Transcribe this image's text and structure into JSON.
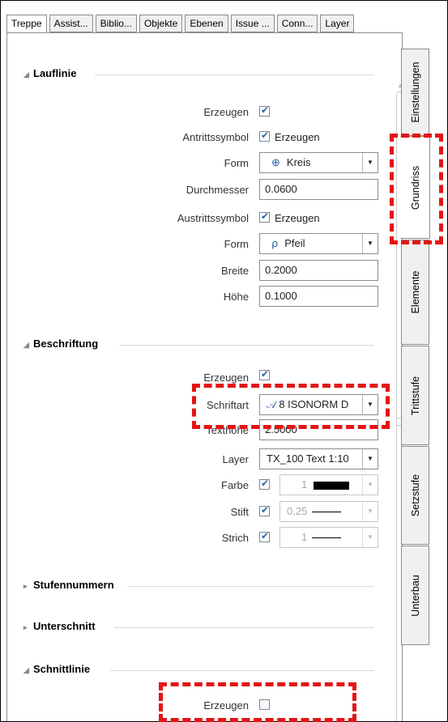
{
  "tabs": [
    "Treppe",
    "Assist...",
    "Biblio...",
    "Objekte",
    "Ebenen",
    "Issue ...",
    "Conn...",
    "Layer"
  ],
  "side_tabs": [
    "Einstellungen",
    "Grundriss",
    "Elemente",
    "Trittstufe",
    "Setzstufe",
    "Unterbau"
  ],
  "sections": {
    "lauflinie": "Lauflinie",
    "beschriftung": "Beschriftung",
    "stufennummern": "Stufennummern",
    "unterschnitt": "Unterschnitt",
    "schnittlinie": "Schnittlinie"
  },
  "lauflinie": {
    "erzeugen_label": "Erzeugen",
    "antritt_label": "Antrittssymbol",
    "antritt_text": "Erzeugen",
    "form1_label": "Form",
    "form1_value": "Kreis",
    "durchmesser_label": "Durchmesser",
    "durchmesser_value": "0.0600",
    "austritt_label": "Austrittssymbol",
    "austritt_text": "Erzeugen",
    "form2_label": "Form",
    "form2_value": "Pfeil",
    "breite_label": "Breite",
    "breite_value": "0.2000",
    "hoehe_label": "Höhe",
    "hoehe_value": "0.1000"
  },
  "beschriftung": {
    "erzeugen_label": "Erzeugen",
    "schriftart_label": "Schriftart",
    "schriftart_value": "8 ISONORM D",
    "texthoehe_label": "Texthöhe",
    "texthoehe_value": "2.5000",
    "layer_label": "Layer",
    "layer_value": "TX_100  Text 1:10",
    "farbe_label": "Farbe",
    "farbe_value": "1",
    "stift_label": "Stift",
    "stift_value": "0.25",
    "strich_label": "Strich",
    "strich_value": "1"
  },
  "schnittlinie": {
    "erzeugen_label": "Erzeugen"
  },
  "colors": {
    "highlight": "#e31515",
    "check": "#2a62a8"
  }
}
